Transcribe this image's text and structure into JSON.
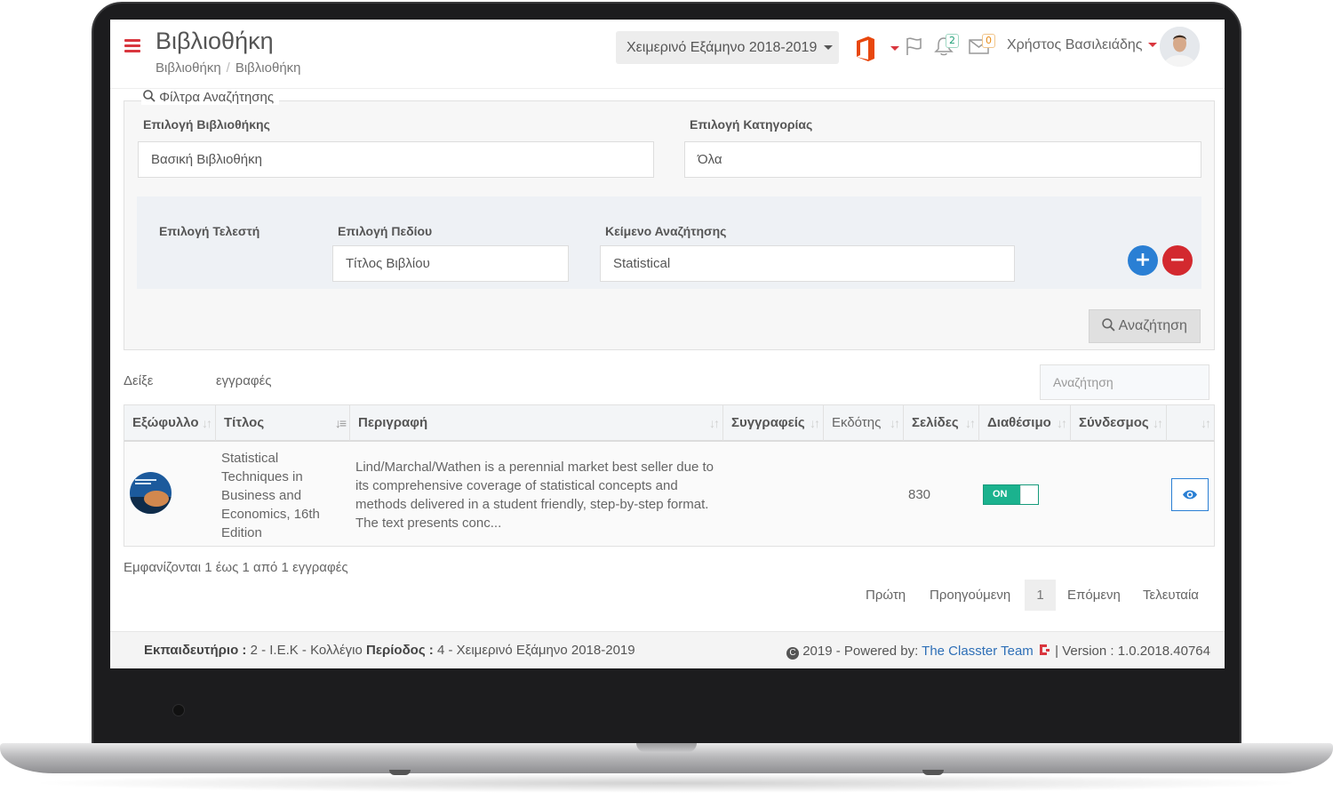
{
  "header": {
    "title": "Βιβλιοθήκη",
    "breadcrumb": [
      "Βιβλιοθήκη",
      "Βιβλιοθήκη"
    ],
    "semester": "Χειμερινό Εξάμηνο 2018-2019",
    "notifications_count": "2",
    "messages_count": "0",
    "user_name": "Χρήστος Βασιλειάδης",
    "icons": [
      "menu-icon",
      "office-icon",
      "flag-icon",
      "bell-icon",
      "mail-icon"
    ]
  },
  "filters": {
    "legend": "Φίλτρα Αναζήτησης",
    "library_label": "Επιλογή Βιβλιοθήκης",
    "library_value": "Βασική Βιβλιοθήκη",
    "category_label": "Επιλογή Κατηγορίας",
    "category_value": "Όλα",
    "operator_label": "Επιλογή Τελεστή",
    "field_label": "Επιλογή Πεδίου",
    "field_value": "Τίτλος Βιβλίου",
    "text_label": "Κείμενο Αναζήτησης",
    "text_value": "Statistical",
    "add_label": "+",
    "remove_label": "−",
    "search_button": "Αναζήτηση"
  },
  "table": {
    "show_label": "Δείξε",
    "entries_label": "εγγραφές",
    "search_placeholder": "Αναζήτηση",
    "columns": [
      "Εξώφυλλο",
      "Τίτλος",
      "Περιγραφή",
      "Συγγραφείς",
      "Εκδότης",
      "Σελίδες",
      "Διαθέσιμο",
      "Σύνδεσμος",
      ""
    ],
    "rows": [
      {
        "title": "Statistical Techniques in Business and Economics, 16th Edition",
        "description": "Lind/Marchal/Wathen is a perennial market best seller due to its comprehensive coverage of statistical concepts and methods delivered in a student friendly, step-by-step format. The text presents conc...",
        "authors": "",
        "publisher": "",
        "pages": "830",
        "available": "ON",
        "link": ""
      }
    ],
    "info": "Εμφανίζονται 1 έως 1 από 1 εγγραφές",
    "pagination": {
      "first": "Πρώτη",
      "previous": "Προηγούμενη",
      "current": "1",
      "next": "Επόμενη",
      "last": "Τελευταία"
    }
  },
  "footer": {
    "center_label": "Εκπαιδευτήριο :",
    "center_value": "2 - Ι.Ε.Κ - Κολλέγιο",
    "period_label": "Περίοδος :",
    "period_value": "4 - Χειμερινό Εξάμηνο 2018-2019",
    "copyright": "2019 - Powered by:",
    "team": "The Classter Team",
    "version": "| Version : 1.0.2018.40764"
  },
  "colors": {
    "accent_red": "#d9363e",
    "primary_blue": "#2a7fd4",
    "toggle_green": "#1bb28e"
  }
}
